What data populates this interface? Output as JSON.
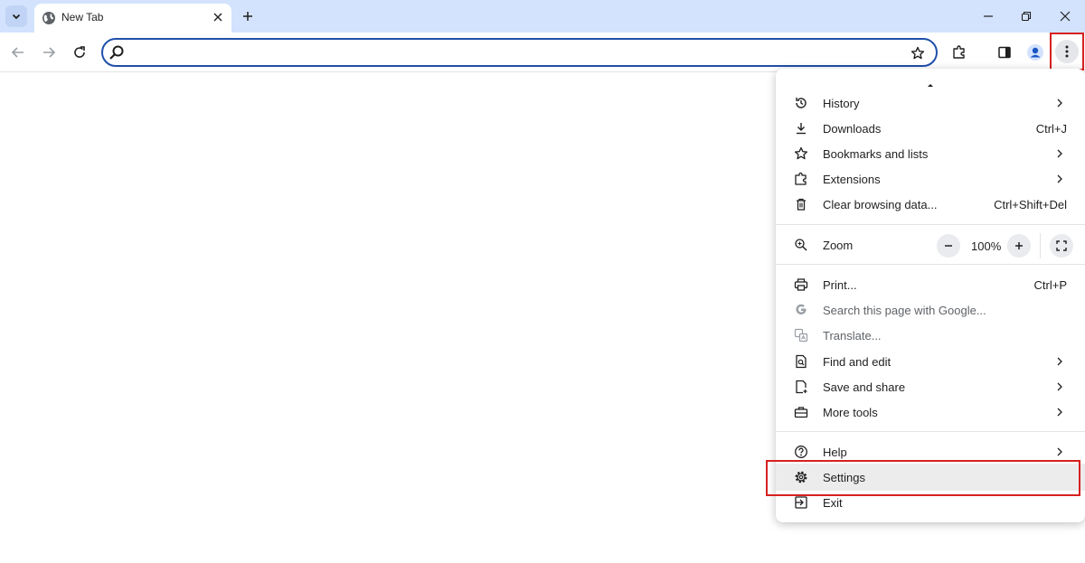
{
  "tab": {
    "title": "New Tab"
  },
  "omnibox": {
    "value": "",
    "placeholder": ""
  },
  "menu": {
    "items": [
      {
        "label": "History",
        "shortcut": ""
      },
      {
        "label": "Downloads",
        "shortcut": "Ctrl+J"
      },
      {
        "label": "Bookmarks and lists",
        "shortcut": ""
      },
      {
        "label": "Extensions",
        "shortcut": ""
      },
      {
        "label": "Clear browsing data...",
        "shortcut": "Ctrl+Shift+Del"
      },
      {
        "label": "Print...",
        "shortcut": "Ctrl+P"
      },
      {
        "label": "Search this page with Google...",
        "shortcut": ""
      },
      {
        "label": "Translate...",
        "shortcut": ""
      },
      {
        "label": "Find and edit",
        "shortcut": ""
      },
      {
        "label": "Save and share",
        "shortcut": ""
      },
      {
        "label": "More tools",
        "shortcut": ""
      },
      {
        "label": "Help",
        "shortcut": ""
      },
      {
        "label": "Settings",
        "shortcut": ""
      },
      {
        "label": "Exit",
        "shortcut": ""
      }
    ],
    "zoom": {
      "label": "Zoom",
      "value": "100%"
    }
  },
  "colors": {
    "titlebar": "#d3e3fd",
    "focus_ring": "#1f4faa",
    "highlight_box": "#d6211f"
  }
}
